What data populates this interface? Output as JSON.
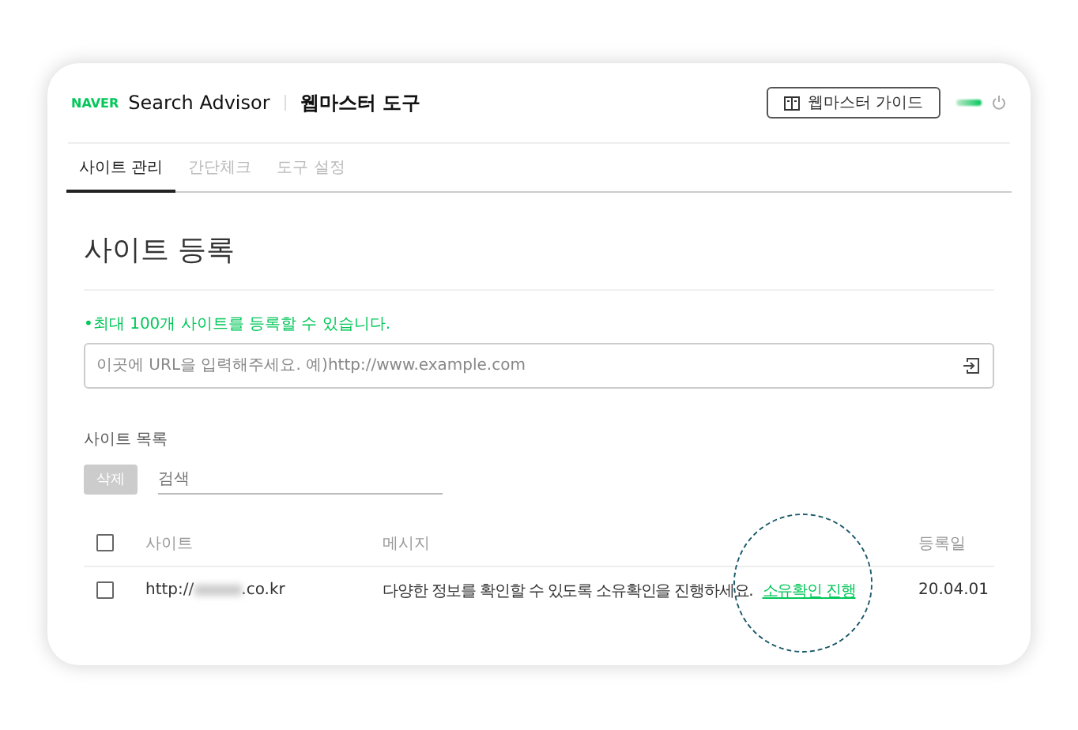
{
  "header": {
    "brand": "NAVER",
    "product": "Search Advisor",
    "section": "웹마스터 도구",
    "guide_button": "웹마스터 가이드"
  },
  "tabs": [
    {
      "label": "사이트 관리",
      "selected": true
    },
    {
      "label": "간단체크",
      "selected": false
    },
    {
      "label": "도구 설정",
      "selected": false
    }
  ],
  "page_title": "사이트 등록",
  "notice": "•최대 100개 사이트를 등록할 수 있습니다.",
  "url_field": {
    "placeholder": "이곳에 URL을 입력해주세요. 예)http://www.example.com"
  },
  "site_list": {
    "title": "사이트 목록",
    "delete_button": "삭제",
    "search": {
      "placeholder": "검색"
    },
    "select_all_checked": false,
    "columns": [
      "사이트",
      "메시지",
      "등록일"
    ],
    "rows": [
      {
        "checked": false,
        "site_prefix": "http://",
        "site_suffix": ".co.kr",
        "message": "다양한 정보를 확인할 수 있도록 소유확인을 진행하세요.",
        "action": "소유확인 진행",
        "date": "20.04.01",
        "highlighted": true
      }
    ]
  }
}
